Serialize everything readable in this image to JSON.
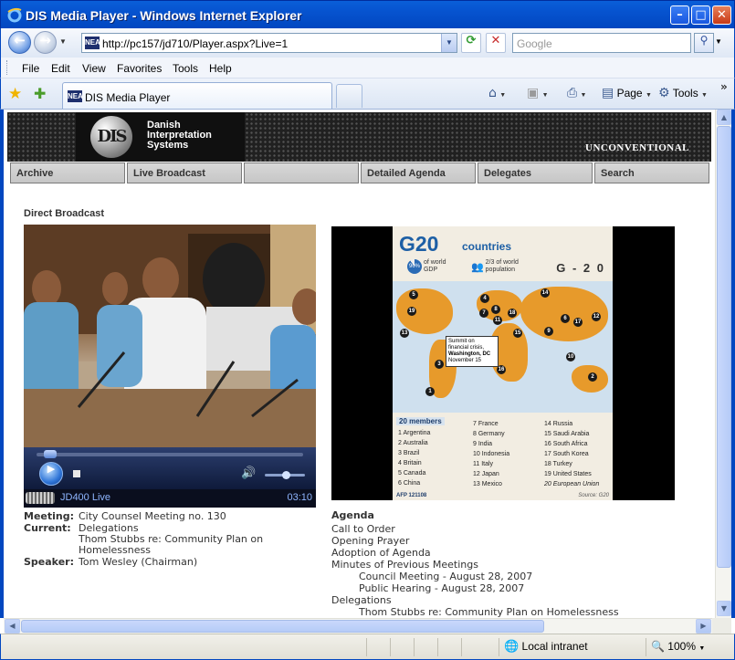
{
  "window": {
    "title": "DIS Media Player - Windows Internet Explorer",
    "minimize_glyph": "–",
    "maximize_glyph": "□",
    "close_glyph": "✕"
  },
  "address_bar": {
    "url": "http://pc157/jd710/Player.aspx?Live=1",
    "favicon_text": "NEA",
    "search_placeholder": "Google",
    "back_glyph": "←",
    "forward_glyph": "→",
    "refresh_glyph": "⟳",
    "stop_glyph": "✕",
    "search_glyph": "⚲"
  },
  "menu": [
    "File",
    "Edit",
    "View",
    "Favorites",
    "Tools",
    "Help"
  ],
  "tabs": {
    "active_label": "DIS Media Player",
    "favicon_text": "NEA"
  },
  "command_bar": {
    "home_icon": "home-icon",
    "feeds_icon": "feeds-icon",
    "print_icon": "print-icon",
    "page_label": "Page",
    "tools_label": "Tools"
  },
  "site": {
    "logo_mark": "DIS",
    "logo_lines": [
      "Danish",
      "Interpretation",
      "Systems"
    ],
    "tagline": "UNCONVENTIONAL",
    "nav": [
      "Archive",
      "Live Broadcast",
      "",
      "Detailed Agenda",
      "Delegates",
      "Search"
    ],
    "section_title": "Direct Broadcast"
  },
  "player": {
    "stream_name": "JD400 Live",
    "time": "03:10",
    "seek_fraction": 0.03,
    "volume_fraction": 0.55,
    "play_glyph": "▶",
    "volume_glyph": "🔊"
  },
  "meeting": {
    "meeting_label": "Meeting:",
    "meeting_value": "City Counsel Meeting no. 130",
    "current_label": "Current:",
    "current_lines": [
      "Delegations",
      "Thom Stubbs re: Community Plan on",
      "Homelessness"
    ],
    "speaker_label": "Speaker:",
    "speaker_value": "Tom Wesley (Chairman)"
  },
  "slide": {
    "title": "G20",
    "subtitle": "countries",
    "logo": "G - 2 0",
    "stat1_pct": "90%",
    "stat1_text": [
      "of world",
      "GDP"
    ],
    "stat2_text": [
      "2/3 of world",
      "population"
    ],
    "callout": [
      "Summit on",
      "financial crisis,",
      "Washington, DC",
      "November 15"
    ],
    "members_header": "20 members",
    "members_col1": [
      "1 Argentina",
      "2 Australia",
      "3 Brazil",
      "4 Britain",
      "5 Canada",
      "6 China"
    ],
    "members_col2": [
      "7 France",
      "8 Germany",
      "9 India",
      "10 Indonesia",
      "11 Italy",
      "12 Japan",
      "13 Mexico"
    ],
    "members_col3": [
      "14 Russia",
      "15 Saudi Arabia",
      "16 South Africa",
      "17 South Korea",
      "18 Turkey",
      "19 United States",
      "20 European Union"
    ],
    "credit": "AFP 121108",
    "source": "Source: G20"
  },
  "agenda": {
    "header": "Agenda",
    "items": [
      {
        "text": "Call to Order",
        "indent": 0
      },
      {
        "text": "Opening Prayer",
        "indent": 0
      },
      {
        "text": "Adoption of Agenda",
        "indent": 0
      },
      {
        "text": "Minutes of Previous Meetings",
        "indent": 0
      },
      {
        "text": "Council Meeting - August 28, 2007",
        "indent": 1
      },
      {
        "text": "Public Hearing - August 28, 2007",
        "indent": 1
      },
      {
        "text": "Delegations",
        "indent": 0
      },
      {
        "text": "Thom Stubbs re: Community Plan on Homelessness",
        "indent": 1
      }
    ]
  },
  "status_bar": {
    "zone": "Local intranet",
    "zoom": "100%"
  }
}
